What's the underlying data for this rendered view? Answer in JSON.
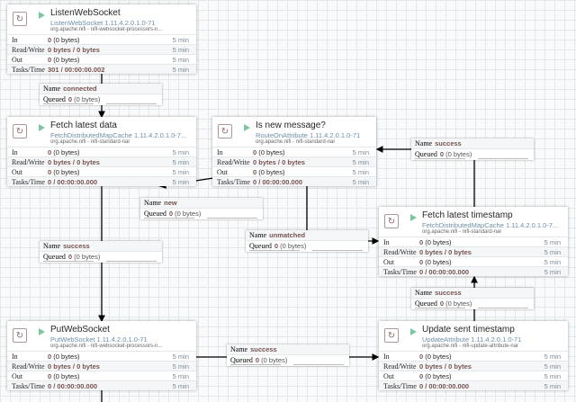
{
  "labels": {
    "in": "In",
    "rw": "Read/Write",
    "out": "Out",
    "tasks": "Tasks/Time",
    "name": "Name",
    "queued": "Queued"
  },
  "processors": [
    {
      "name": "ListenWebSocket",
      "type": "ListenWebSocket 1.11.4.2.0.1.0-71",
      "bundle": "org.apache.nifi - nifi-websocket-processors-n...",
      "in_count": "0",
      "in_bytes": "(0 bytes)",
      "rw": "0 bytes / 0 bytes",
      "out_count": "0",
      "out_bytes": "(0 bytes)",
      "tasks": "301 / 00:00:00.002",
      "window": "5 min"
    },
    {
      "name": "Fetch latest data",
      "type": "FetchDistributedMapCache 1.11.4.2.0.1.0-7...",
      "bundle": "org.apache.nifi - nifi-standard-nar",
      "in_count": "0",
      "in_bytes": "(0 bytes)",
      "rw": "0 bytes / 0 bytes",
      "out_count": "0",
      "out_bytes": "(0 bytes)",
      "tasks": "0 / 00:00:00.000",
      "window": "5 min"
    },
    {
      "name": "Is new message?",
      "type": "RouteOnAttribute 1.11.4.2.0.1.0-71",
      "bundle": "org.apache.nifi - nifi-standard-nar",
      "in_count": "0",
      "in_bytes": "(0 bytes)",
      "rw": "0 bytes / 0 bytes",
      "out_count": "0",
      "out_bytes": "(0 bytes)",
      "tasks": "0 / 00:00:00.000",
      "window": "5 min"
    },
    {
      "name": "Fetch latest timestamp",
      "type": "FetchDistributedMapCache 1.11.4.2.0.1.0-7...",
      "bundle": "org.apache.nifi - nifi-standard-nar",
      "in_count": "0",
      "in_bytes": "(0 bytes)",
      "rw": "0 bytes / 0 bytes",
      "out_count": "0",
      "out_bytes": "(0 bytes)",
      "tasks": "0 / 00:00:00.000",
      "window": "5 min"
    },
    {
      "name": "PutWebSocket",
      "type": "PutWebSocket 1.11.4.2.0.1.0-71",
      "bundle": "org.apache.nifi - nifi-websocket-processors-n...",
      "in_count": "0",
      "in_bytes": "(0 bytes)",
      "rw": "0 bytes / 0 bytes",
      "out_count": "0",
      "out_bytes": "(0 bytes)",
      "tasks": "0 / 00:00:00.000",
      "window": "5 min"
    },
    {
      "name": "Update sent timestamp",
      "type": "UpdateAttribute 1.11.4.2.0.1.0-71",
      "bundle": "org.apache.nifi - nifi-update-attribute-nar",
      "in_count": "0",
      "in_bytes": "(0 bytes)",
      "rw": "0 bytes / 0 bytes",
      "out_count": "0",
      "out_bytes": "(0 bytes)",
      "tasks": "0 / 00:00:00.000",
      "window": "5 min"
    }
  ],
  "connections": [
    {
      "name": "connected",
      "queued_count": "0",
      "queued_bytes": "(0 bytes)"
    },
    {
      "name": "new",
      "queued_count": "0",
      "queued_bytes": "(0 bytes)"
    },
    {
      "name": "success",
      "queued_count": "0",
      "queued_bytes": "(0 bytes)"
    },
    {
      "name": "unmatched",
      "queued_count": "0",
      "queued_bytes": "(0 bytes)"
    },
    {
      "name": "success",
      "queued_count": "0",
      "queued_bytes": "(0 bytes)"
    },
    {
      "name": "success",
      "queued_count": "0",
      "queued_bytes": "(0 bytes)"
    },
    {
      "name": "success",
      "queued_count": "0",
      "queued_bytes": "(0 bytes)"
    }
  ]
}
